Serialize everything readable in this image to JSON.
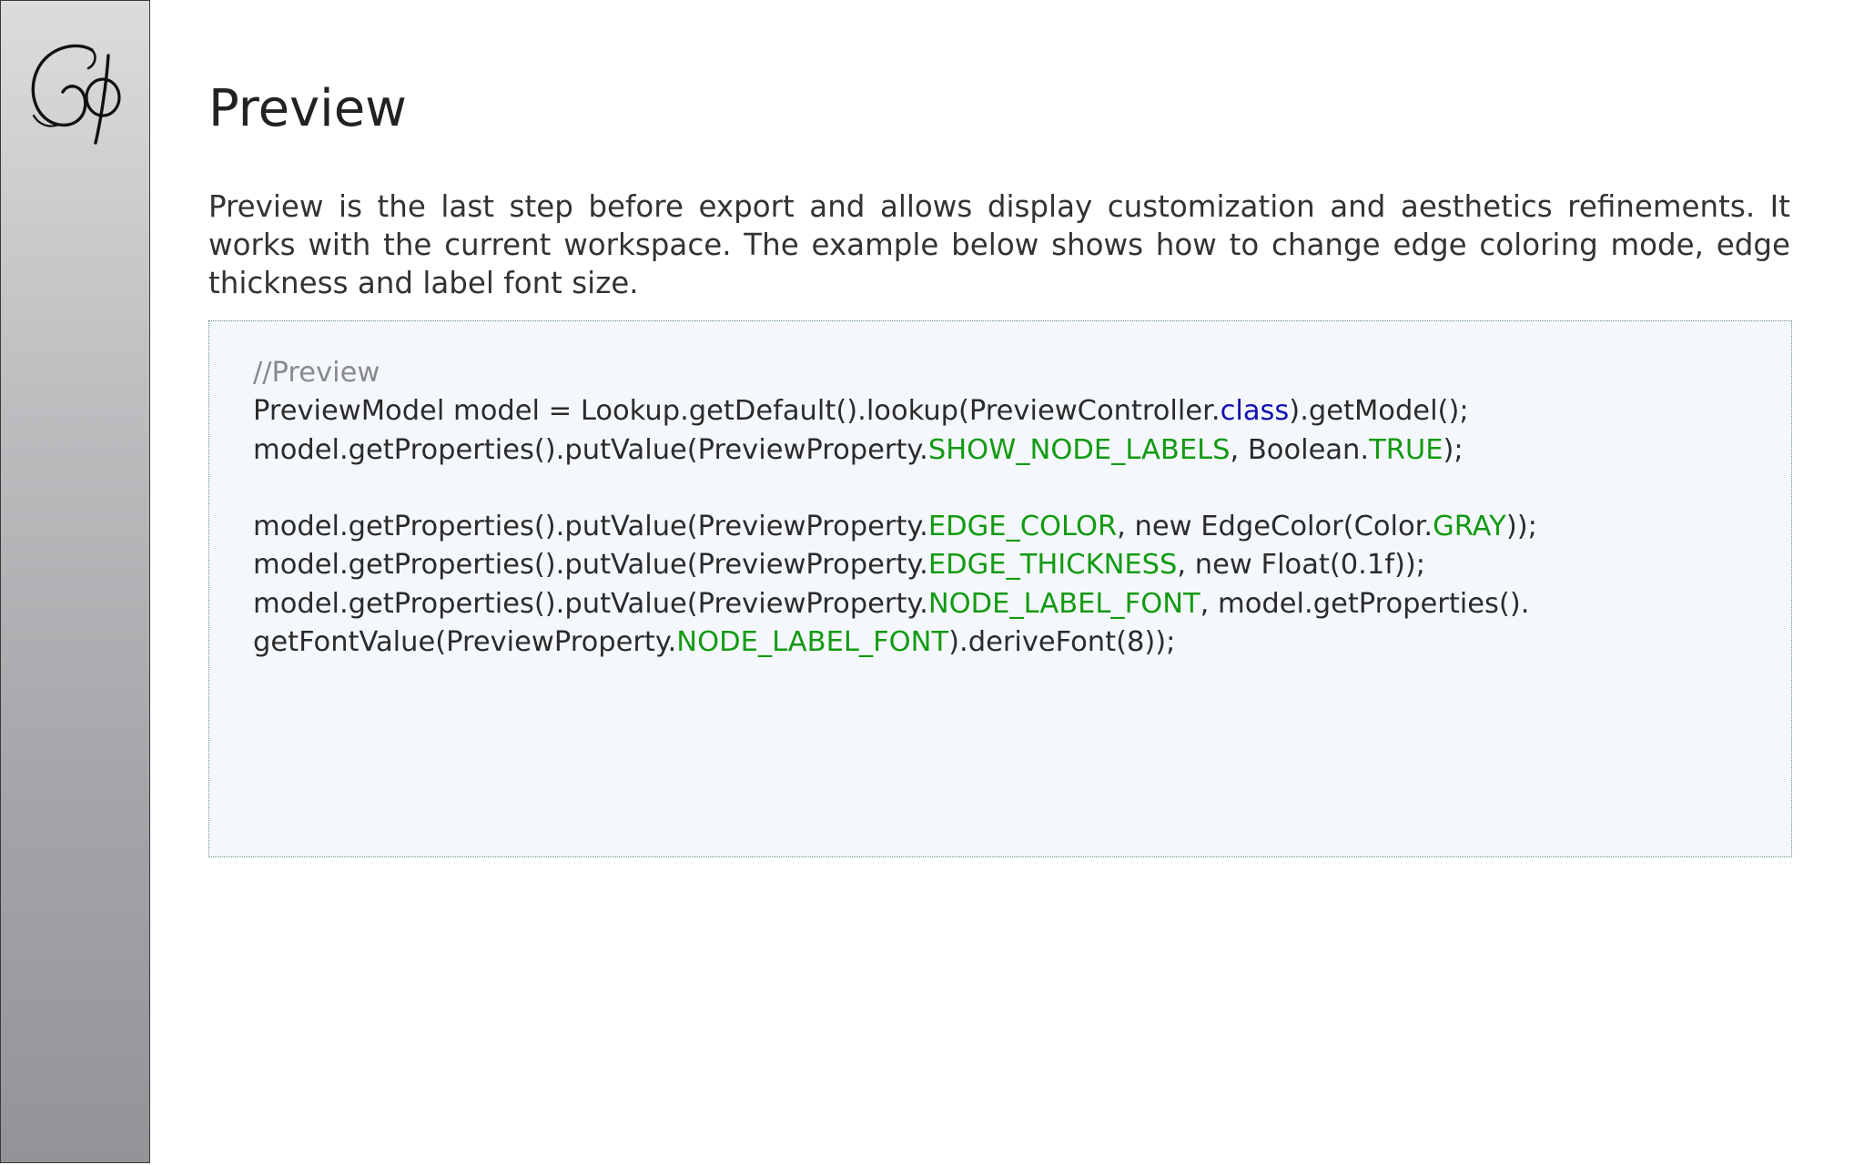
{
  "page": {
    "title": "Preview",
    "intro": "Preview is the last step before export and allows display customization and aesthetics refinements. It works with the current workspace. The example below shows how to change edge coloring mode, edge thickness and label font size."
  },
  "logo": {
    "text": "Gφ"
  },
  "code": {
    "lines": [
      [
        {
          "t": "//Preview",
          "k": "comment"
        }
      ],
      [
        {
          "t": "PreviewModel model = Lookup.getDefault().lookup(PreviewController.",
          "k": "plain"
        },
        {
          "t": "class",
          "k": "kw"
        },
        {
          "t": ").getModel();",
          "k": "plain"
        }
      ],
      [
        {
          "t": "model.getProperties().putValue(PreviewProperty.",
          "k": "plain"
        },
        {
          "t": "SHOW_NODE_LABELS",
          "k": "const"
        },
        {
          "t": ", Boolean.",
          "k": "plain"
        },
        {
          "t": "TRUE",
          "k": "const"
        },
        {
          "t": ");",
          "k": "plain"
        }
      ],
      [],
      [
        {
          "t": "model.getProperties().putValue(PreviewProperty.",
          "k": "plain"
        },
        {
          "t": "EDGE_COLOR",
          "k": "const"
        },
        {
          "t": ", new EdgeColor(Color.",
          "k": "plain"
        },
        {
          "t": "GRAY",
          "k": "const"
        },
        {
          "t": "));",
          "k": "plain"
        }
      ],
      [
        {
          "t": "model.getProperties().putValue(PreviewProperty.",
          "k": "plain"
        },
        {
          "t": "EDGE_THICKNESS",
          "k": "const"
        },
        {
          "t": ", new Float(0.1f));",
          "k": "plain"
        }
      ],
      [
        {
          "t": "model.getProperties().putValue(PreviewProperty.",
          "k": "plain"
        },
        {
          "t": "NODE_LABEL_FONT",
          "k": "const"
        },
        {
          "t": ", model.getProperties().",
          "k": "plain"
        }
      ],
      [
        {
          "t": "getFontValue(PreviewProperty.",
          "k": "plain"
        },
        {
          "t": "NODE_LABEL_FONT",
          "k": "const"
        },
        {
          "t": ").deriveFont(8));",
          "k": "plain"
        }
      ]
    ]
  },
  "colors": {
    "comment": "#8a8a8a",
    "keyword": "#1010b0",
    "constant": "#139a13",
    "code_background": "#f4f8fc",
    "sidebar_top": "#dcdcdc",
    "sidebar_bottom": "#939398"
  }
}
